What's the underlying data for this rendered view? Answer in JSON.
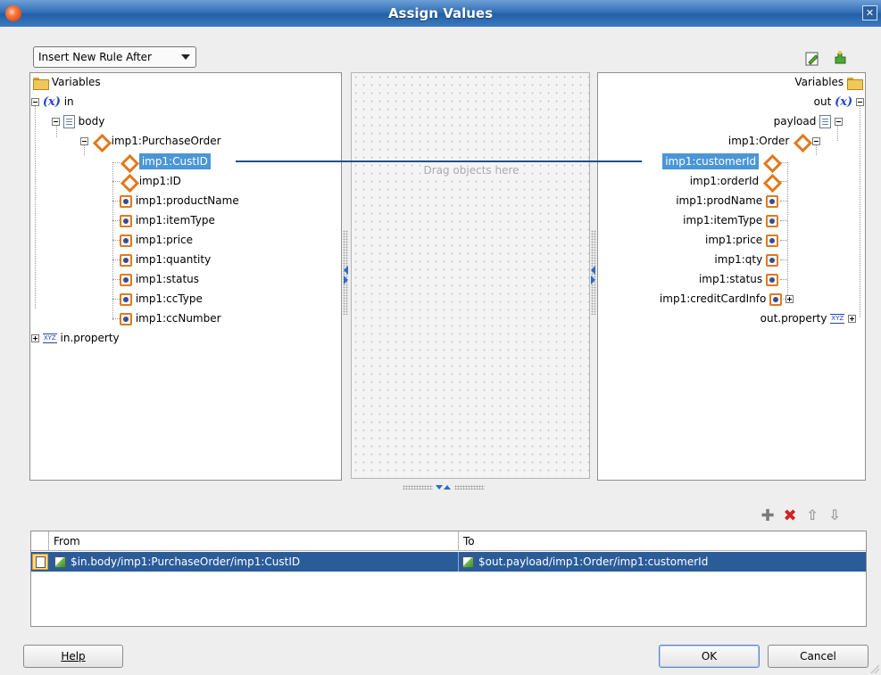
{
  "window": {
    "title": "Assign Values",
    "close_glyph": "✕"
  },
  "toolbar": {
    "insert_dropdown": "Insert New Rule After",
    "icons": [
      "edit-expression-icon",
      "rule-wizard-icon"
    ]
  },
  "source_tree": {
    "root_label": "Variables",
    "in": {
      "var_glyph": "(x)",
      "label": "in"
    },
    "body": "body",
    "purchase_order": "imp1:PurchaseOrder",
    "children": [
      "imp1:CustID",
      "imp1:ID",
      "imp1:productName",
      "imp1:itemType",
      "imp1:price",
      "imp1:quantity",
      "imp1:status",
      "imp1:ccType",
      "imp1:ccNumber"
    ],
    "property_glyph": "XYZ",
    "in_property": "in.property"
  },
  "middle": {
    "drag_hint": "Drag objects here"
  },
  "target_tree": {
    "root_label": "Variables",
    "out": {
      "var_glyph": "(x)",
      "label": "out"
    },
    "payload": "payload",
    "order": "imp1:Order",
    "children": [
      "imp1:customerId",
      "imp1:orderId",
      "imp1:prodName",
      "imp1:itemType",
      "imp1:price",
      "imp1:qty",
      "imp1:status",
      "imp1:creditCardInfo"
    ],
    "property_glyph": "XYZ",
    "out_property": "out.property"
  },
  "mapping": {
    "from": "imp1:CustID",
    "to": "imp1:customerId"
  },
  "rule_actions": [
    {
      "name": "add-rule-button",
      "glyph": "✚",
      "color": "#7a7a7a"
    },
    {
      "name": "delete-rule-button",
      "glyph": "✖",
      "color": "#d42020"
    },
    {
      "name": "move-up-button",
      "glyph": "⇧",
      "color": "#9a9a9a"
    },
    {
      "name": "move-down-button",
      "glyph": "⇩",
      "color": "#9a9a9a"
    }
  ],
  "rules_table": {
    "headers": [
      "From",
      "To"
    ],
    "rows": [
      {
        "from": "$in.body/imp1:PurchaseOrder/imp1:CustID",
        "to": "$out.payload/imp1:Order/imp1:customerId",
        "selected": true
      }
    ]
  },
  "buttons": {
    "help": "Help",
    "ok": "OK",
    "cancel": "Cancel"
  },
  "colors": {
    "title_bar": "#2f6db5",
    "selection": "#4a96d6",
    "row_selected": "#2b5c9a",
    "connector": "#1f4f8c",
    "element_icon": "#e07a1e"
  }
}
